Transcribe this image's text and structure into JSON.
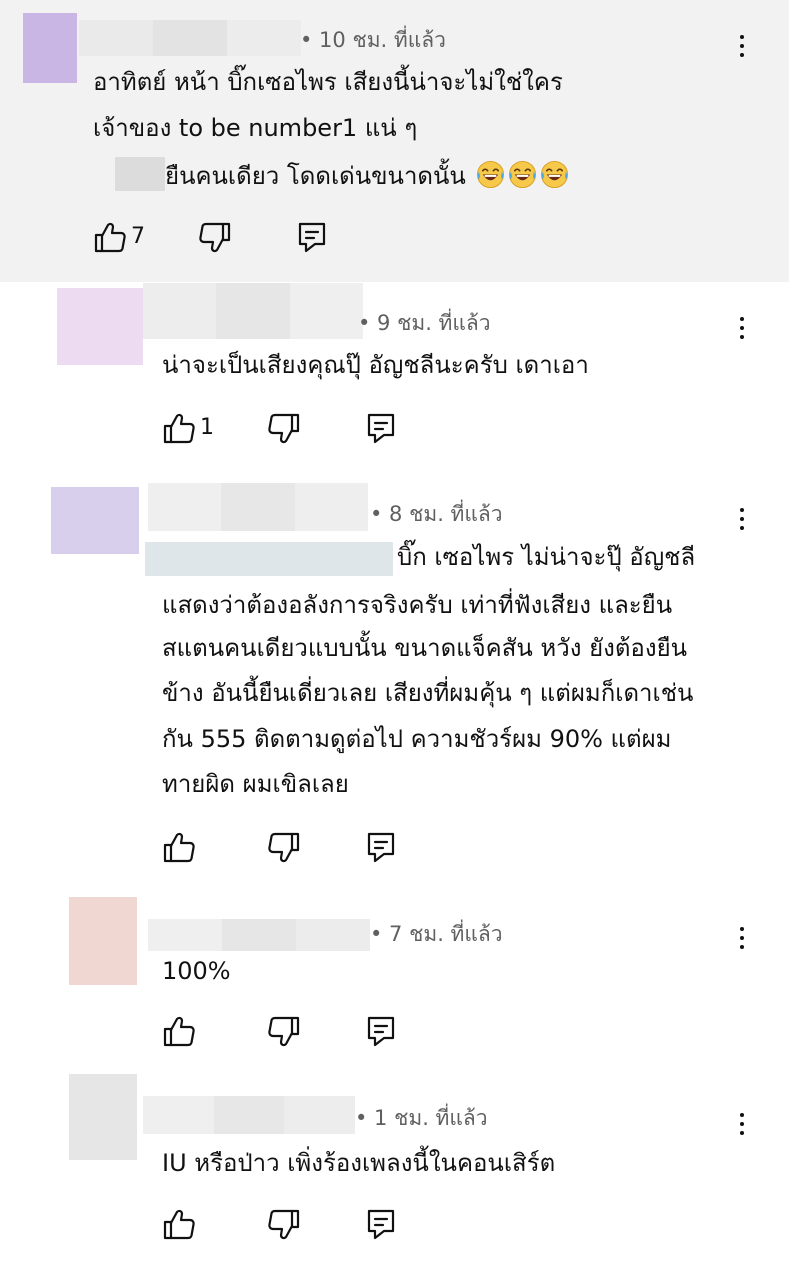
{
  "comments": [
    {
      "time": "• 10 ชม. ที่แล้ว",
      "lines": [
        "อาทิตย์ หน้า บิ๊กเซอไพร เสียงนี้น่าจะไม่ใช่ใคร",
        "เจ้าของ to be number1 แน่ ๆ",
        "ยืนคนเดียว โดดเด่นขนาดนั้น"
      ],
      "emoji": "face-with-tears-of-joy",
      "likes": "7",
      "avatar_color": "#c9b6e4",
      "highlighted": true
    },
    {
      "time": "• 9 ชม. ที่แล้ว",
      "lines": [
        "น่าจะเป็นเสียงคุณปุ๊ อัญชลีนะครับ เดาเอา"
      ],
      "likes": "1",
      "avatar_color": "#eddcf1"
    },
    {
      "time": "• 8 ชม. ที่แล้ว",
      "lines": [
        "บิ๊ก เซอไพร ไม่น่าจะปุ๊ อัญชลี",
        "แสดงว่าต้องอลังการจริงครับ เท่าที่ฟังเสียง และยืน",
        "สแตนคนเดียวแบบนั้น ขนาดแจ็คสัน หวัง ยังต้องยืน",
        "ข้าง อันนี้ยืนเดี่ยวเลย เสียงที่ผมคุ้น ๆ แต่ผมก็เดาเช่น",
        "กัน 555 ติดตามดูต่อไป ความชัวร์ผม 90% แต่ผม",
        "ทายผิด ผมเขิลเลย"
      ],
      "likes": "",
      "avatar_color": "#d8cfec"
    },
    {
      "time": "• 7 ชม. ที่แล้ว",
      "lines": [
        "100%"
      ],
      "likes": "",
      "avatar_color": "#f1d7d2"
    },
    {
      "time": "• 1 ชม. ที่แล้ว",
      "lines": [
        "IU หรือป่าว เพิ่งร้องเพลงนี้ในคอนเสิร์ต"
      ],
      "likes": "",
      "avatar_color": "#e6e6e6"
    }
  ],
  "icons": {
    "like": "thumb-up-icon",
    "dislike": "thumb-down-icon",
    "reply": "reply-icon",
    "more": "more-vert-icon"
  }
}
